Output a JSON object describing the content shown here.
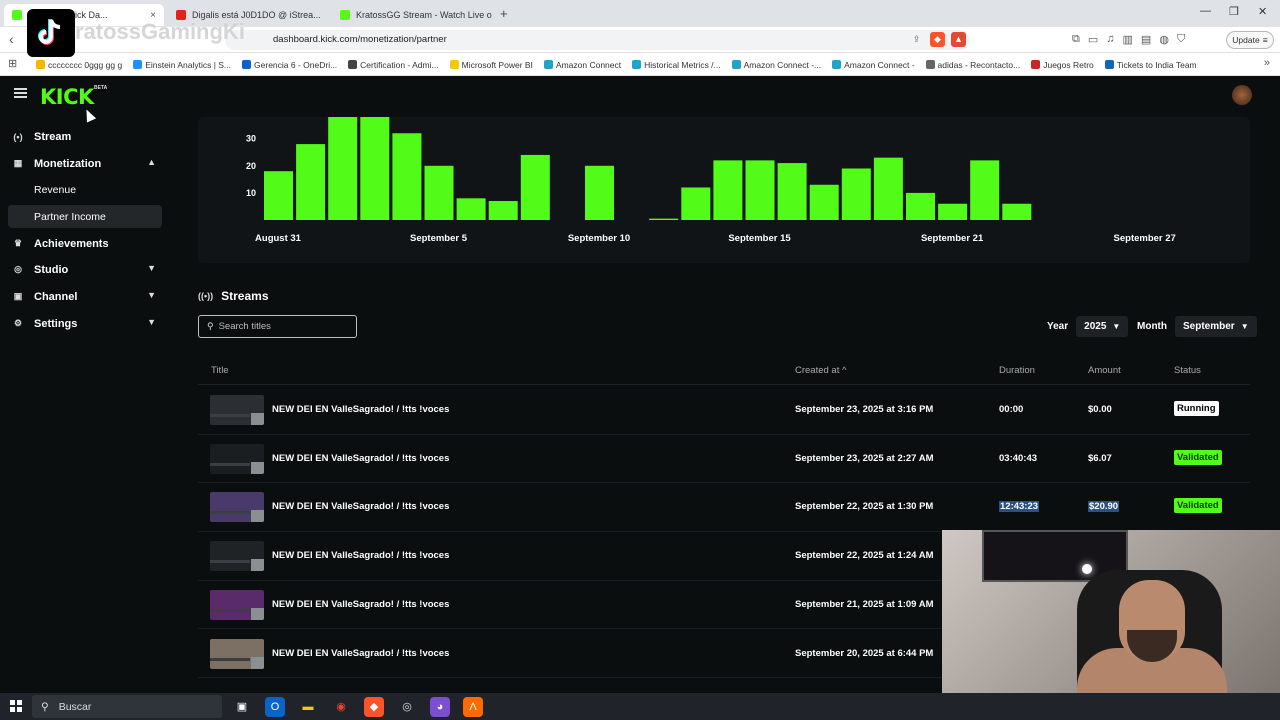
{
  "browser": {
    "tabs": [
      {
        "title": "...ogram - Kick Da...",
        "favicon": "#53fc18",
        "close": "×"
      },
      {
        "title": "Digalis está J0D1DO @ iStrea...",
        "favicon": "#e62117",
        "close": ""
      },
      {
        "title": "KratossGG Stream - Watch Live on Ki...",
        "favicon": "#53fc18",
        "close": "×"
      }
    ],
    "new_tab": "+",
    "url": "dashboard.kick.com/monetization/partner",
    "update_label": "Update",
    "bookmarks": [
      {
        "label": "cccccccc 0ggg gg  g",
        "color": "#f5b800"
      },
      {
        "label": "Einstein Analytics | S...",
        "color": "#1e90ff"
      },
      {
        "label": "Gerencia 6 - OneDri...",
        "color": "#0a64c8"
      },
      {
        "label": "Certification - Admi...",
        "color": "#444444"
      },
      {
        "label": "Microsoft Power BI",
        "color": "#f2c811"
      },
      {
        "label": "Amazon Connect",
        "color": "#21a3c7"
      },
      {
        "label": "Historical Metrics /...",
        "color": "#21a3c7"
      },
      {
        "label": "Amazon Connect -...",
        "color": "#21a3c7"
      },
      {
        "label": "Amazon Connect -",
        "color": "#21a3c7"
      },
      {
        "label": "adidas - Recontacto...",
        "color": "#666666"
      },
      {
        "label": "Juegos Retro",
        "color": "#c62828"
      },
      {
        "label": "Tickets to India Team",
        "color": "#1565c0"
      }
    ]
  },
  "overlay": {
    "username": "ratossGamingKi"
  },
  "kick": {
    "logo": "KICK",
    "beta": "BETA",
    "sidebar": [
      {
        "label": "Stream",
        "icon": "broadcast-icon",
        "glyph": "(•)",
        "chev": ""
      },
      {
        "label": "Monetization",
        "icon": "chart-icon",
        "glyph": "▦",
        "chev": "^"
      },
      {
        "label": "Revenue",
        "icon": "",
        "glyph": "",
        "chev": ""
      },
      {
        "label": "Partner Income",
        "icon": "",
        "glyph": "",
        "chev": ""
      },
      {
        "label": "Achievements",
        "icon": "trophy-icon",
        "glyph": "🏆",
        "chev": ""
      },
      {
        "label": "Studio",
        "icon": "studio-icon",
        "glyph": "◎",
        "chev": "v"
      },
      {
        "label": "Channel",
        "icon": "channel-icon",
        "glyph": "▣",
        "chev": "v"
      },
      {
        "label": "Settings",
        "icon": "gear-icon",
        "glyph": "⚙",
        "chev": "v"
      }
    ],
    "streams": {
      "title": "Streams",
      "search_placeholder": "Search titles",
      "year_label": "Year",
      "year_value": "2025",
      "month_label": "Month",
      "month_value": "September",
      "columns": {
        "title": "Title",
        "created": "Created at",
        "duration": "Duration",
        "amount": "Amount",
        "status": "Status"
      },
      "rows": [
        {
          "title": "NEW DEI EN ValleSagrado! / !tts !voces",
          "created": "September 23, 2025 at 3:16 PM",
          "duration": "00:00",
          "amount": "$0.00",
          "status": "Running"
        },
        {
          "title": "NEW DEI EN ValleSagrado! / !tts !voces",
          "created": "September 23, 2025 at 2:27 AM",
          "duration": "03:40:43",
          "amount": "$6.07",
          "status": "Validated"
        },
        {
          "title": "NEW DEI EN ValleSagrado! / !tts !voces",
          "created": "September 22, 2025 at 1:30 PM",
          "duration": "12:43:23",
          "amount": "$20.90",
          "status": "Validated"
        },
        {
          "title": "NEW DEI EN ValleSagrado! / !tts !voces",
          "created": "September 22, 2025 at 1:24 AM",
          "duration": "",
          "amount": "",
          "status": ""
        },
        {
          "title": "NEW DEI EN ValleSagrado! / !tts !voces",
          "created": "September 21, 2025 at 1:09 AM",
          "duration": "",
          "amount": "",
          "status": ""
        },
        {
          "title": "NEW DEI EN ValleSagrado! / !tts !voces",
          "created": "September 20, 2025 at 6:44 PM",
          "duration": "",
          "amount": "",
          "status": ""
        }
      ]
    }
  },
  "chart_data": {
    "type": "bar",
    "color": "#53fc18",
    "y_ticks": [
      10,
      20,
      30
    ],
    "ylim": [
      0,
      38
    ],
    "x_tick_labels": [
      "August 31",
      "September 5",
      "September 10",
      "September 15",
      "September 21",
      "September 27"
    ],
    "x_tick_days": [
      31,
      36,
      41,
      46,
      52,
      58
    ],
    "x_days": [
      31,
      32,
      33,
      34,
      35,
      36,
      37,
      38,
      39,
      41,
      43,
      44,
      45,
      46,
      47,
      48,
      49,
      50,
      51,
      52,
      53
    ],
    "values": [
      18,
      28,
      38,
      38,
      32,
      20,
      8,
      7,
      24,
      20,
      0.5,
      12,
      22,
      22,
      21,
      13,
      19,
      23,
      10,
      6,
      22,
      6
    ]
  },
  "taskbar": {
    "search_label": "Buscar"
  }
}
